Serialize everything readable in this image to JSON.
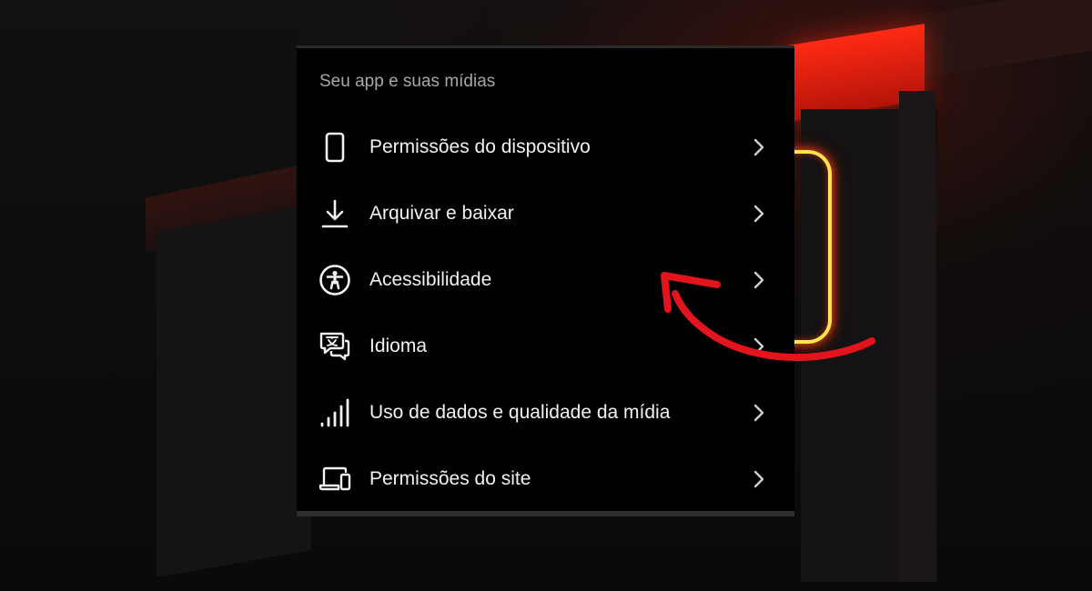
{
  "settings": {
    "section_title": "Seu app e suas mídias",
    "items": [
      {
        "label": "Permissões do dispositivo",
        "icon": "phone-icon"
      },
      {
        "label": "Arquivar e baixar",
        "icon": "download-icon"
      },
      {
        "label": "Acessibilidade",
        "icon": "accessibility-icon"
      },
      {
        "label": "Idioma",
        "icon": "language-icon"
      },
      {
        "label": "Uso de dados e qualidade da mídia",
        "icon": "signal-bars-icon"
      },
      {
        "label": "Permissões do site",
        "icon": "devices-icon"
      }
    ]
  },
  "colors": {
    "panel_background": "#000000",
    "label_text": "#f2f2f2",
    "section_title_text": "#a8a8a8",
    "annotation_arrow": "#e3141c"
  }
}
